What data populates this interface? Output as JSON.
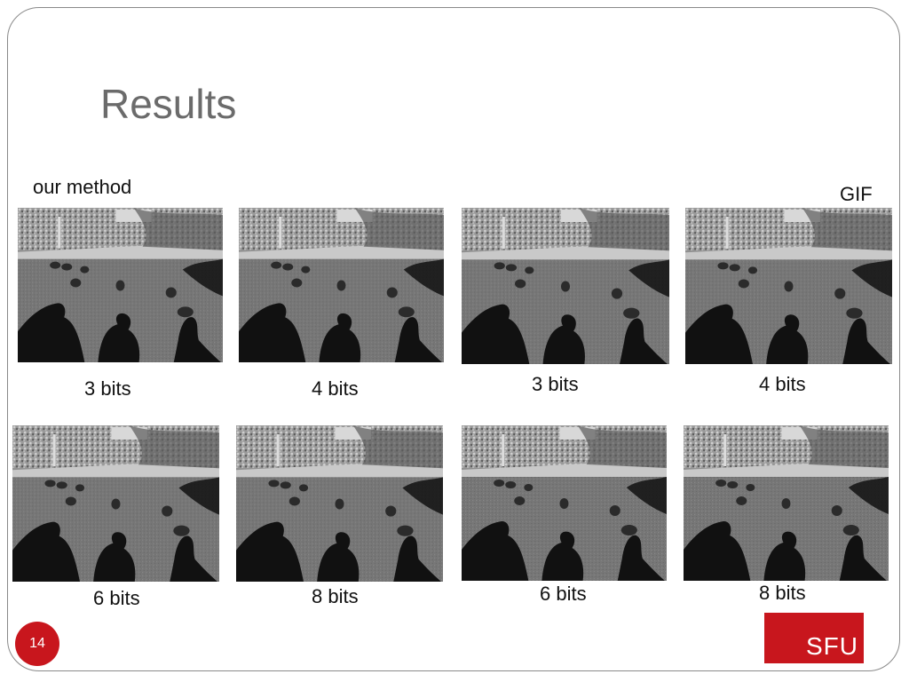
{
  "slide": {
    "title": "Results",
    "page_number": "14",
    "logo_text": "SFU"
  },
  "labels": {
    "our_method": "our method",
    "gif": "GIF"
  },
  "captions": {
    "ours_top_1": "3 bits",
    "ours_top_2": "4 bits",
    "gif_top_1": "3 bits",
    "gif_top_2": "4 bits",
    "ours_bottom_1": "6 bits",
    "ours_bottom_2": "8 bits",
    "gif_bottom_1": "6 bits",
    "gif_bottom_2": "8 bits"
  },
  "images": {
    "subject": "geese-on-lawn-with-shadows",
    "count": 8
  }
}
